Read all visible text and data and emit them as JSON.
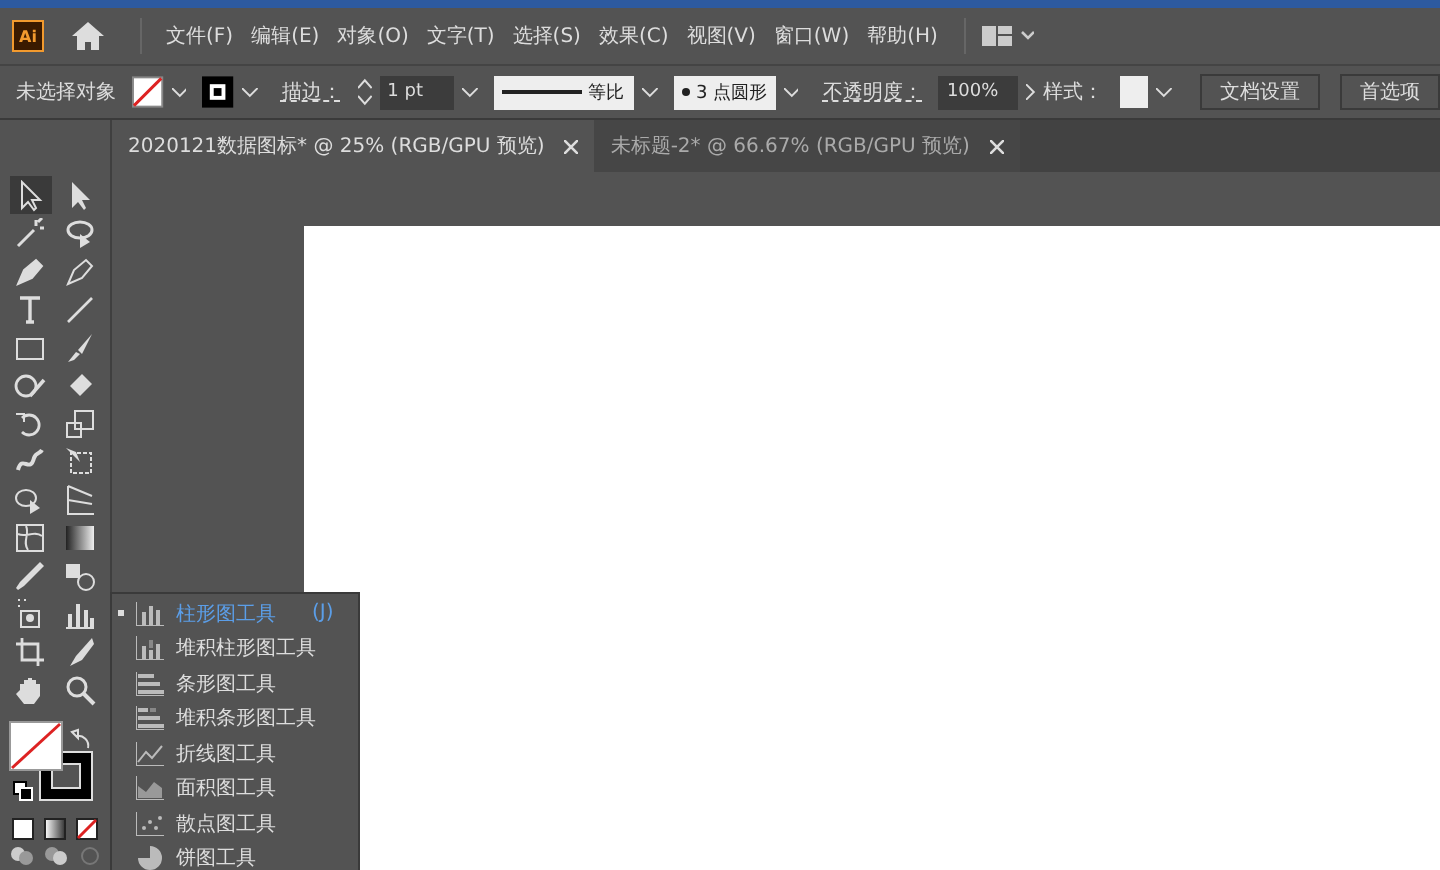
{
  "logo": "Ai",
  "menu": [
    "文件(F)",
    "编辑(E)",
    "对象(O)",
    "文字(T)",
    "选择(S)",
    "效果(C)",
    "视图(V)",
    "窗口(W)",
    "帮助(H)"
  ],
  "control_bar": {
    "selection_label": "未选择对象",
    "stroke_label": "描边：",
    "stroke_weight": "1 pt",
    "stroke_profile": "等比",
    "brush": "3 点圆形",
    "opacity_label": "不透明度：",
    "opacity": "100%",
    "style_label": "样式：",
    "buttons": [
      "文档设置",
      "首选项"
    ]
  },
  "tabs": [
    {
      "label": "2020121数据图标* @ 25% (RGB/GPU 预览)",
      "selected": true
    },
    {
      "label": "未标题-2* @ 66.67% (RGB/GPU 预览)",
      "selected": false
    }
  ],
  "tools": [
    {
      "kind": "select",
      "selected": true
    },
    {
      "kind": "direct",
      "selected": false
    },
    {
      "kind": "wand",
      "selected": false
    },
    {
      "kind": "lasso",
      "selected": false
    },
    {
      "kind": "pen",
      "selected": false
    },
    {
      "kind": "curvature",
      "selected": false
    },
    {
      "kind": "type",
      "selected": false
    },
    {
      "kind": "line",
      "selected": false
    },
    {
      "kind": "rect",
      "selected": false
    },
    {
      "kind": "brush",
      "selected": false
    },
    {
      "kind": "shaper",
      "selected": false
    },
    {
      "kind": "eraser",
      "selected": false
    },
    {
      "kind": "rotate",
      "selected": false
    },
    {
      "kind": "scale",
      "selected": false
    },
    {
      "kind": "warp",
      "selected": false
    },
    {
      "kind": "transform",
      "selected": false
    },
    {
      "kind": "builder",
      "selected": false
    },
    {
      "kind": "perspective",
      "selected": false
    },
    {
      "kind": "mesh",
      "selected": false
    },
    {
      "kind": "gradient",
      "selected": false
    },
    {
      "kind": "eyedropper",
      "selected": false
    },
    {
      "kind": "blend",
      "selected": false
    },
    {
      "kind": "symbol",
      "selected": false
    },
    {
      "kind": "graph",
      "selected": false
    },
    {
      "kind": "artboard",
      "selected": false
    },
    {
      "kind": "slice",
      "selected": false
    },
    {
      "kind": "hand",
      "selected": false
    },
    {
      "kind": "zoom",
      "selected": false
    }
  ],
  "flyout": [
    {
      "kind": "column",
      "label": "柱形图工具",
      "shortcut": "(J)",
      "selected": true
    },
    {
      "kind": "stacked-column",
      "label": "堆积柱形图工具",
      "selected": false
    },
    {
      "kind": "bar",
      "label": "条形图工具",
      "selected": false
    },
    {
      "kind": "stacked-bar",
      "label": "堆积条形图工具",
      "selected": false
    },
    {
      "kind": "line",
      "label": "折线图工具",
      "selected": false
    },
    {
      "kind": "area",
      "label": "面积图工具",
      "selected": false
    },
    {
      "kind": "scatter",
      "label": "散点图工具",
      "selected": false
    },
    {
      "kind": "pie",
      "label": "饼图工具",
      "selected": false
    }
  ]
}
